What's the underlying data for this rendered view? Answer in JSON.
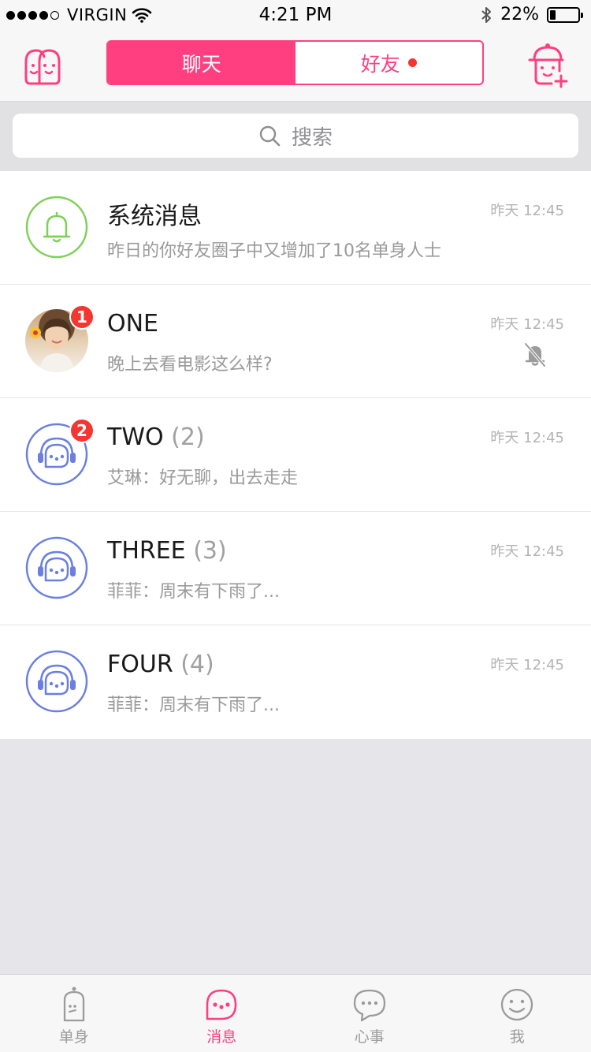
{
  "status_bar": {
    "carrier": "VIRGIN",
    "time": "4:21 PM",
    "battery": "22%",
    "battery_level": 0.22
  },
  "nav": {
    "tabs": [
      {
        "label": "聊天",
        "active": true
      },
      {
        "label": "好友",
        "active": false,
        "has_dot": true
      }
    ],
    "left_icon": "couple-icon",
    "right_icon": "add-friend-icon"
  },
  "search": {
    "placeholder": "搜索"
  },
  "colors": {
    "accent": "#ff3f7f",
    "badge": "#f43530",
    "system_green": "#7ed157",
    "group_blue": "#6a7fe0"
  },
  "conversations": [
    {
      "title": "系统消息",
      "count": "",
      "preview": "昨日的你好友圈子中又增加了10名单身人士",
      "time": "昨天 12:45",
      "avatar": "bell-icon",
      "badge": "",
      "muted": false
    },
    {
      "title": "ONE",
      "count": "",
      "preview": "晚上去看电影这么样?",
      "time": "昨天 12:45",
      "avatar": "user-photo",
      "badge": "1",
      "muted": true
    },
    {
      "title": "TWO",
      "count": "(2)",
      "preview": "艾琳：好无聊，出去走走",
      "time": "昨天 12:45",
      "avatar": "group-icon",
      "badge": "2",
      "muted": false
    },
    {
      "title": "THREE",
      "count": "(3)",
      "preview": "菲菲：周末有下雨了...",
      "time": "昨天 12:45",
      "avatar": "group-icon",
      "badge": "",
      "muted": false
    },
    {
      "title": "FOUR",
      "count": "(4)",
      "preview": "菲菲：周末有下雨了...",
      "time": "昨天 12:45",
      "avatar": "group-icon",
      "badge": "",
      "muted": false
    }
  ],
  "tabbar": [
    {
      "label": "单身",
      "icon": "single-icon",
      "active": false
    },
    {
      "label": "消息",
      "icon": "message-icon",
      "active": true
    },
    {
      "label": "心事",
      "icon": "thoughts-icon",
      "active": false
    },
    {
      "label": "我",
      "icon": "smiley-icon",
      "active": false
    }
  ]
}
